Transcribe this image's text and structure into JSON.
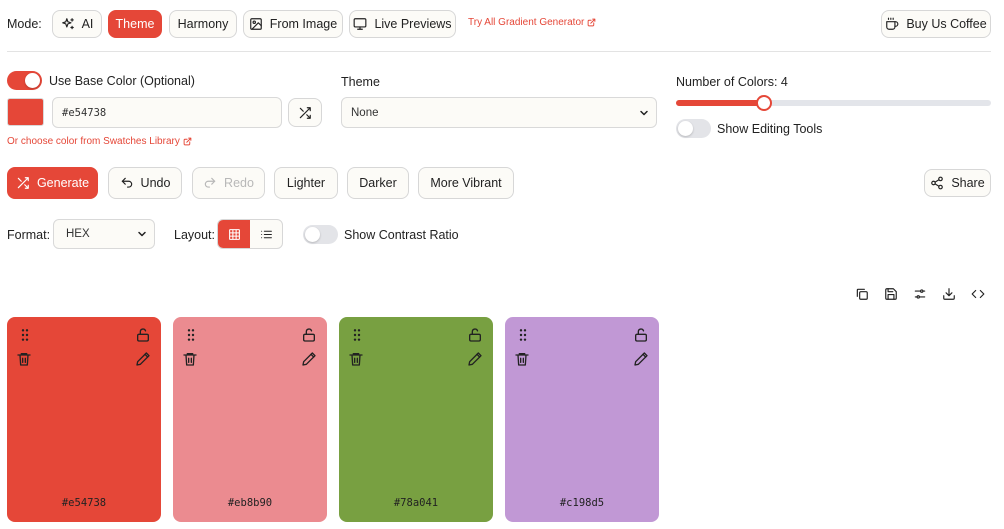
{
  "mode": {
    "label": "Mode:",
    "buttons": {
      "ai": "AI",
      "theme": "Theme",
      "harmony": "Harmony",
      "from_image": "From Image",
      "live_previews": "Live Previews"
    },
    "gradient_link": "Try All Gradient Generator",
    "buy_coffee": "Buy Us Coffee"
  },
  "base_color": {
    "toggle_label": "Use Base Color (Optional)",
    "enabled": true,
    "value": "#e54738",
    "swatch_link": "Or choose color from Swatches Library"
  },
  "theme": {
    "label": "Theme",
    "selected": "None"
  },
  "num_colors": {
    "label": "Number of Colors: 4",
    "value": 4,
    "fill_fraction": 0.28
  },
  "editing_tools": {
    "label": "Show Editing Tools",
    "enabled": false
  },
  "actions": {
    "generate": "Generate",
    "undo": "Undo",
    "redo": "Redo",
    "lighter": "Lighter",
    "darker": "Darker",
    "more_vibrant": "More Vibrant",
    "share": "Share"
  },
  "format": {
    "label": "Format:",
    "selected": "HEX"
  },
  "layout": {
    "label": "Layout:",
    "active": "grid"
  },
  "contrast": {
    "label": "Show Contrast Ratio",
    "enabled": false
  },
  "colors": {
    "accent": "#e54738",
    "palette": [
      {
        "hex": "#e54738",
        "color": "#e54738"
      },
      {
        "hex": "#eb8b90",
        "color": "#eb8b90"
      },
      {
        "hex": "#78a041",
        "color": "#78a041"
      },
      {
        "hex": "#c198d5",
        "color": "#c198d5"
      }
    ]
  }
}
